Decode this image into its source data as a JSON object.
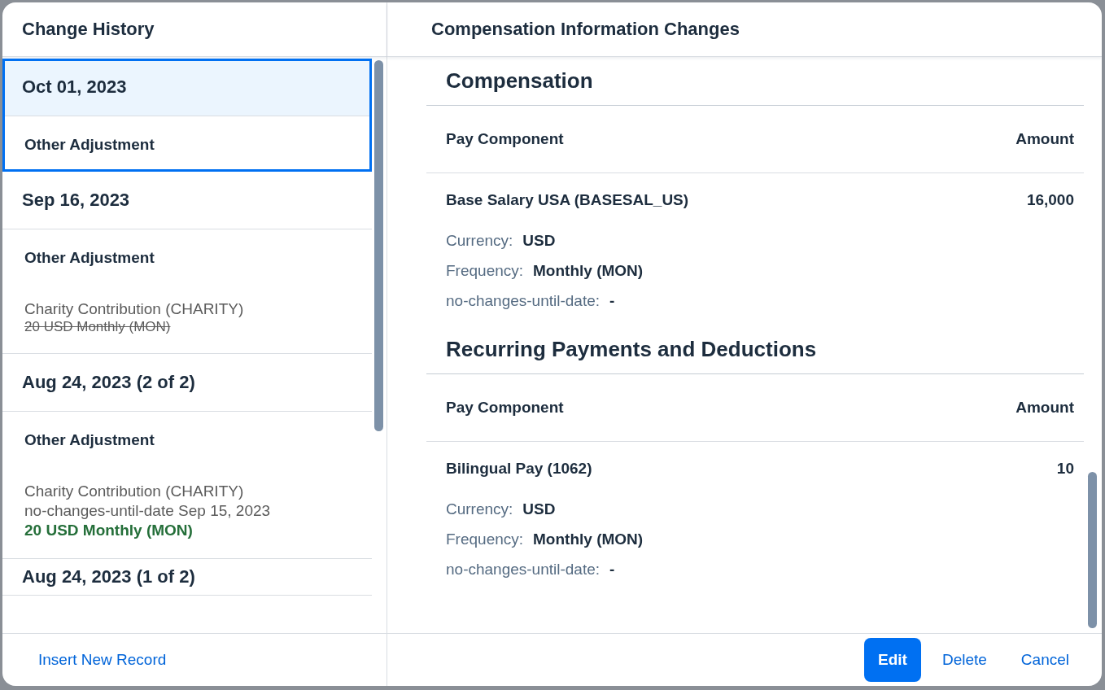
{
  "left_panel": {
    "title": "Change History",
    "records": [
      {
        "date": "Oct 01, 2023",
        "selected": true,
        "entries": [
          {
            "title": "Other Adjustment"
          }
        ]
      },
      {
        "date": "Sep 16, 2023",
        "selected": false,
        "entries": [
          {
            "title": "Other Adjustment",
            "lines": [
              {
                "kind": "plain",
                "text": "Charity Contribution (CHARITY)"
              },
              {
                "kind": "removed",
                "text": "20 USD Monthly (MON)"
              }
            ]
          }
        ]
      },
      {
        "date": "Aug 24, 2023 (2 of 2)",
        "selected": false,
        "entries": [
          {
            "title": "Other Adjustment",
            "lines": [
              {
                "kind": "plain",
                "text": "Charity Contribution (CHARITY)"
              },
              {
                "kind": "plain",
                "text": "no-changes-until-date Sep 15, 2023"
              },
              {
                "kind": "added",
                "text": "20 USD Monthly (MON)"
              }
            ]
          }
        ]
      },
      {
        "date": "Aug 24, 2023 (1 of 2)",
        "selected": false
      }
    ],
    "footer_link": "Insert New Record"
  },
  "right_panel": {
    "title": "Compensation Information Changes",
    "sections": [
      {
        "title": "Compensation",
        "columns": [
          "Pay Component",
          "Amount"
        ],
        "rows": [
          {
            "name": "Base Salary USA (BASESAL_US)",
            "amount": "16,000",
            "fields": [
              {
                "label": "Currency:",
                "value": "USD"
              },
              {
                "label": "Frequency:",
                "value": "Monthly (MON)"
              },
              {
                "label": "no-changes-until-date:",
                "value": "-"
              }
            ]
          }
        ]
      },
      {
        "title": "Recurring Payments and Deductions",
        "columns": [
          "Pay Component",
          "Amount"
        ],
        "rows": [
          {
            "name": "Bilingual Pay (1062)",
            "amount": "10",
            "fields": [
              {
                "label": "Currency:",
                "value": "USD"
              },
              {
                "label": "Frequency:",
                "value": "Monthly (MON)"
              },
              {
                "label": "no-changes-until-date:",
                "value": "-"
              }
            ]
          }
        ]
      }
    ],
    "buttons": [
      {
        "label": "Edit",
        "kind": "primary"
      },
      {
        "label": "Delete",
        "kind": "transparent"
      },
      {
        "label": "Cancel",
        "kind": "transparent"
      }
    ]
  }
}
